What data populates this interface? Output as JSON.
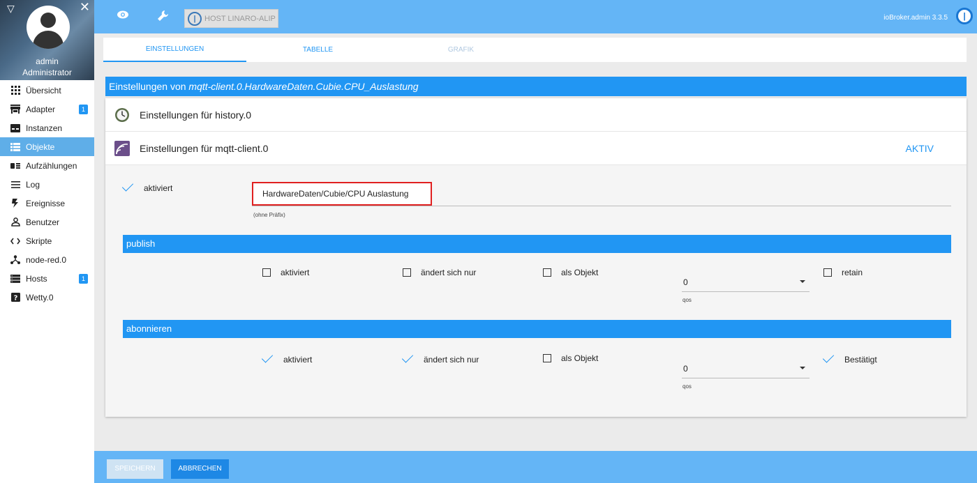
{
  "sidebar": {
    "user_name": "admin",
    "user_role": "Administrator",
    "items": [
      {
        "label": "Übersicht",
        "icon": "apps-icon"
      },
      {
        "label": "Adapter",
        "icon": "store-icon",
        "badge": "1"
      },
      {
        "label": "Instanzen",
        "icon": "instances-icon"
      },
      {
        "label": "Objekte",
        "icon": "list-icon"
      },
      {
        "label": "Aufzählungen",
        "icon": "enums-icon"
      },
      {
        "label": "Log",
        "icon": "menu-lines-icon"
      },
      {
        "label": "Ereignisse",
        "icon": "flash-icon"
      },
      {
        "label": "Benutzer",
        "icon": "user-icon"
      },
      {
        "label": "Skripte",
        "icon": "code-icon"
      },
      {
        "label": "node-red.0",
        "icon": "node-red-icon"
      },
      {
        "label": "Hosts",
        "icon": "server-icon",
        "badge": "1"
      },
      {
        "label": "Wetty.0",
        "icon": "help-icon"
      }
    ],
    "active": "Objekte"
  },
  "topbar": {
    "host_label": "HOST LINARO-ALIP",
    "version": "ioBroker.admin 3.3.5"
  },
  "tabs": [
    {
      "label": "EINSTELLUNGEN",
      "state": "active"
    },
    {
      "label": "TABELLE",
      "state": "normal"
    },
    {
      "label": "GRAFIK",
      "state": "disabled"
    }
  ],
  "panel": {
    "title_prefix": "Einstellungen von ",
    "title_object": "mqtt-client.0.HardwareDaten.Cubie.CPU_Auslastung",
    "history_label": "Einstellungen für history.0",
    "mqtt_label": "Einstellungen für mqtt-client.0",
    "aktiv_label": "AKTIV",
    "enabled_label": "aktiviert",
    "topic_value": "HardwareDaten/Cubie/CPU Auslastung",
    "topic_hint": "(ohne Präfix)"
  },
  "publish": {
    "header": "publish",
    "aktiviert": "aktiviert",
    "aendert": "ändert sich nur",
    "als_objekt": "als Objekt",
    "qos_value": "0",
    "qos_label": "qos",
    "retain": "retain"
  },
  "subscribe": {
    "header": "abonnieren",
    "aktiviert": "aktiviert",
    "aendert": "ändert sich nur",
    "als_objekt": "als Objekt",
    "qos_value": "0",
    "qos_label": "qos",
    "ack": "Bestätigt"
  },
  "footer": {
    "save": "SPEICHERN",
    "cancel": "ABBRECHEN"
  }
}
